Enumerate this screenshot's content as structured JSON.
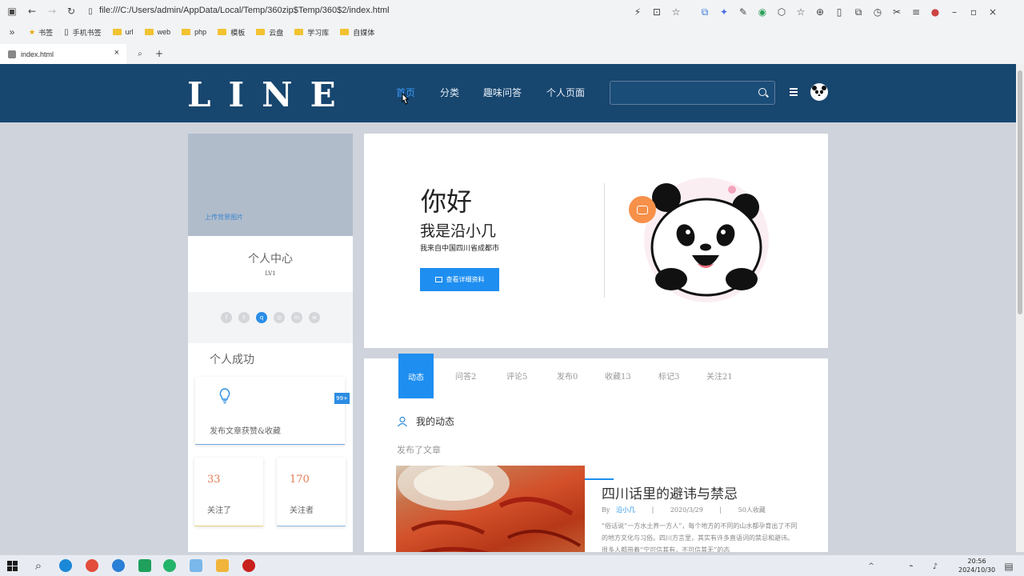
{
  "browser": {
    "url": "file:///C:/Users/admin/AppData/Local/Temp/360zip$Temp/360$2/index.html",
    "bookmarks": [
      "书签",
      "手机书签",
      "url",
      "web",
      "php",
      "模板",
      "云盘",
      "学习库",
      "自媒体"
    ],
    "tab_title": "index.html"
  },
  "header": {
    "logo": "LINE",
    "nav": [
      "首页",
      "分类",
      "趣味问答",
      "个人页面"
    ],
    "search_placeholder": ""
  },
  "sidebar": {
    "upload_cover": "上传背景图片",
    "center_title": "个人中心",
    "level": "LV1",
    "success_title": "个人成功",
    "badge": "99+",
    "achievement": "发布文章获赞&收藏",
    "following_count": "33",
    "following_label": "关注了",
    "followers_count": "170",
    "followers_label": "关注者"
  },
  "hero": {
    "hello": "你好",
    "iam": "我是沿小几",
    "from": "我来自中国四川省成都市",
    "button": "查看详细资料"
  },
  "content": {
    "tabs": [
      "动态",
      "问答2",
      "评论5",
      "发布0",
      "收藏13",
      "标记3",
      "关注21"
    ],
    "section_title": "我的动态",
    "published_label": "发布了文章",
    "article": {
      "title": "四川话里的避讳与禁忌",
      "by": "By",
      "author": "沿小几",
      "date": "2020/3/29",
      "favorites": "50人收藏",
      "body": "“俗话说“一方水土养一方人”，每个地方的不同的山水都孕育出了不同的地方文化与习俗。四川方言里，其实有许多直语词的禁忌和避讳。很多人都带着“宁可信其有，不可信其无”的态"
    }
  },
  "taskbar": {
    "time": "20:56",
    "date": "2024/10/30"
  }
}
